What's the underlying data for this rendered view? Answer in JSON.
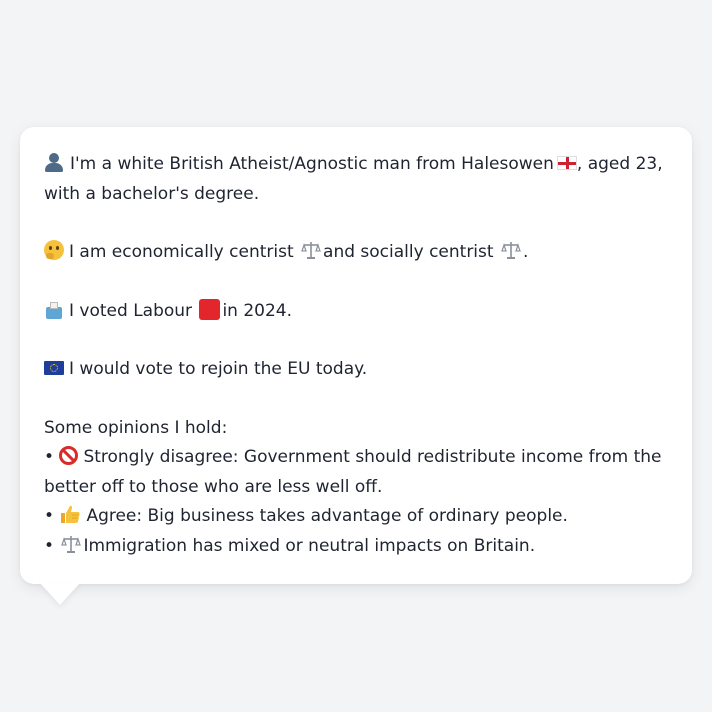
{
  "message": {
    "intro": "I'm a white British Atheist/Agnostic man from Halesowen",
    "intro_tail": ", aged 23, with a bachelor's degree.",
    "politics_a": "I am economically centrist",
    "politics_b": "and socially centrist",
    "politics_end": ".",
    "vote_a": "I voted Labour",
    "vote_b": "in 2024.",
    "eu": "I would vote to rejoin the EU today.",
    "opinions_heading": "Some opinions I hold:",
    "bullet": "•",
    "opinions": [
      {
        "icon": "prohibited-icon",
        "text": "Strongly disagree: Government should redistribute income from the better off to those who are less well off."
      },
      {
        "icon": "thumbs-up-icon",
        "text": "Agree: Big business takes advantage of ordinary people."
      },
      {
        "icon": "balance-scale-icon",
        "text": "Immigration has mixed or neutral impacts on Britain."
      }
    ]
  },
  "icons": {
    "person": "person-silhouette-icon",
    "flag": "england-flag-icon",
    "thinking": "thinking-face-icon",
    "scale": "balance-scale-icon",
    "ballot": "ballot-box-icon",
    "party_color": "red-square-icon",
    "eu_flag": "eu-flag-icon"
  },
  "colors": {
    "background": "#f3f4f6",
    "bubble": "#ffffff",
    "text": "#1f2430",
    "labour_red": "#e3262c"
  }
}
